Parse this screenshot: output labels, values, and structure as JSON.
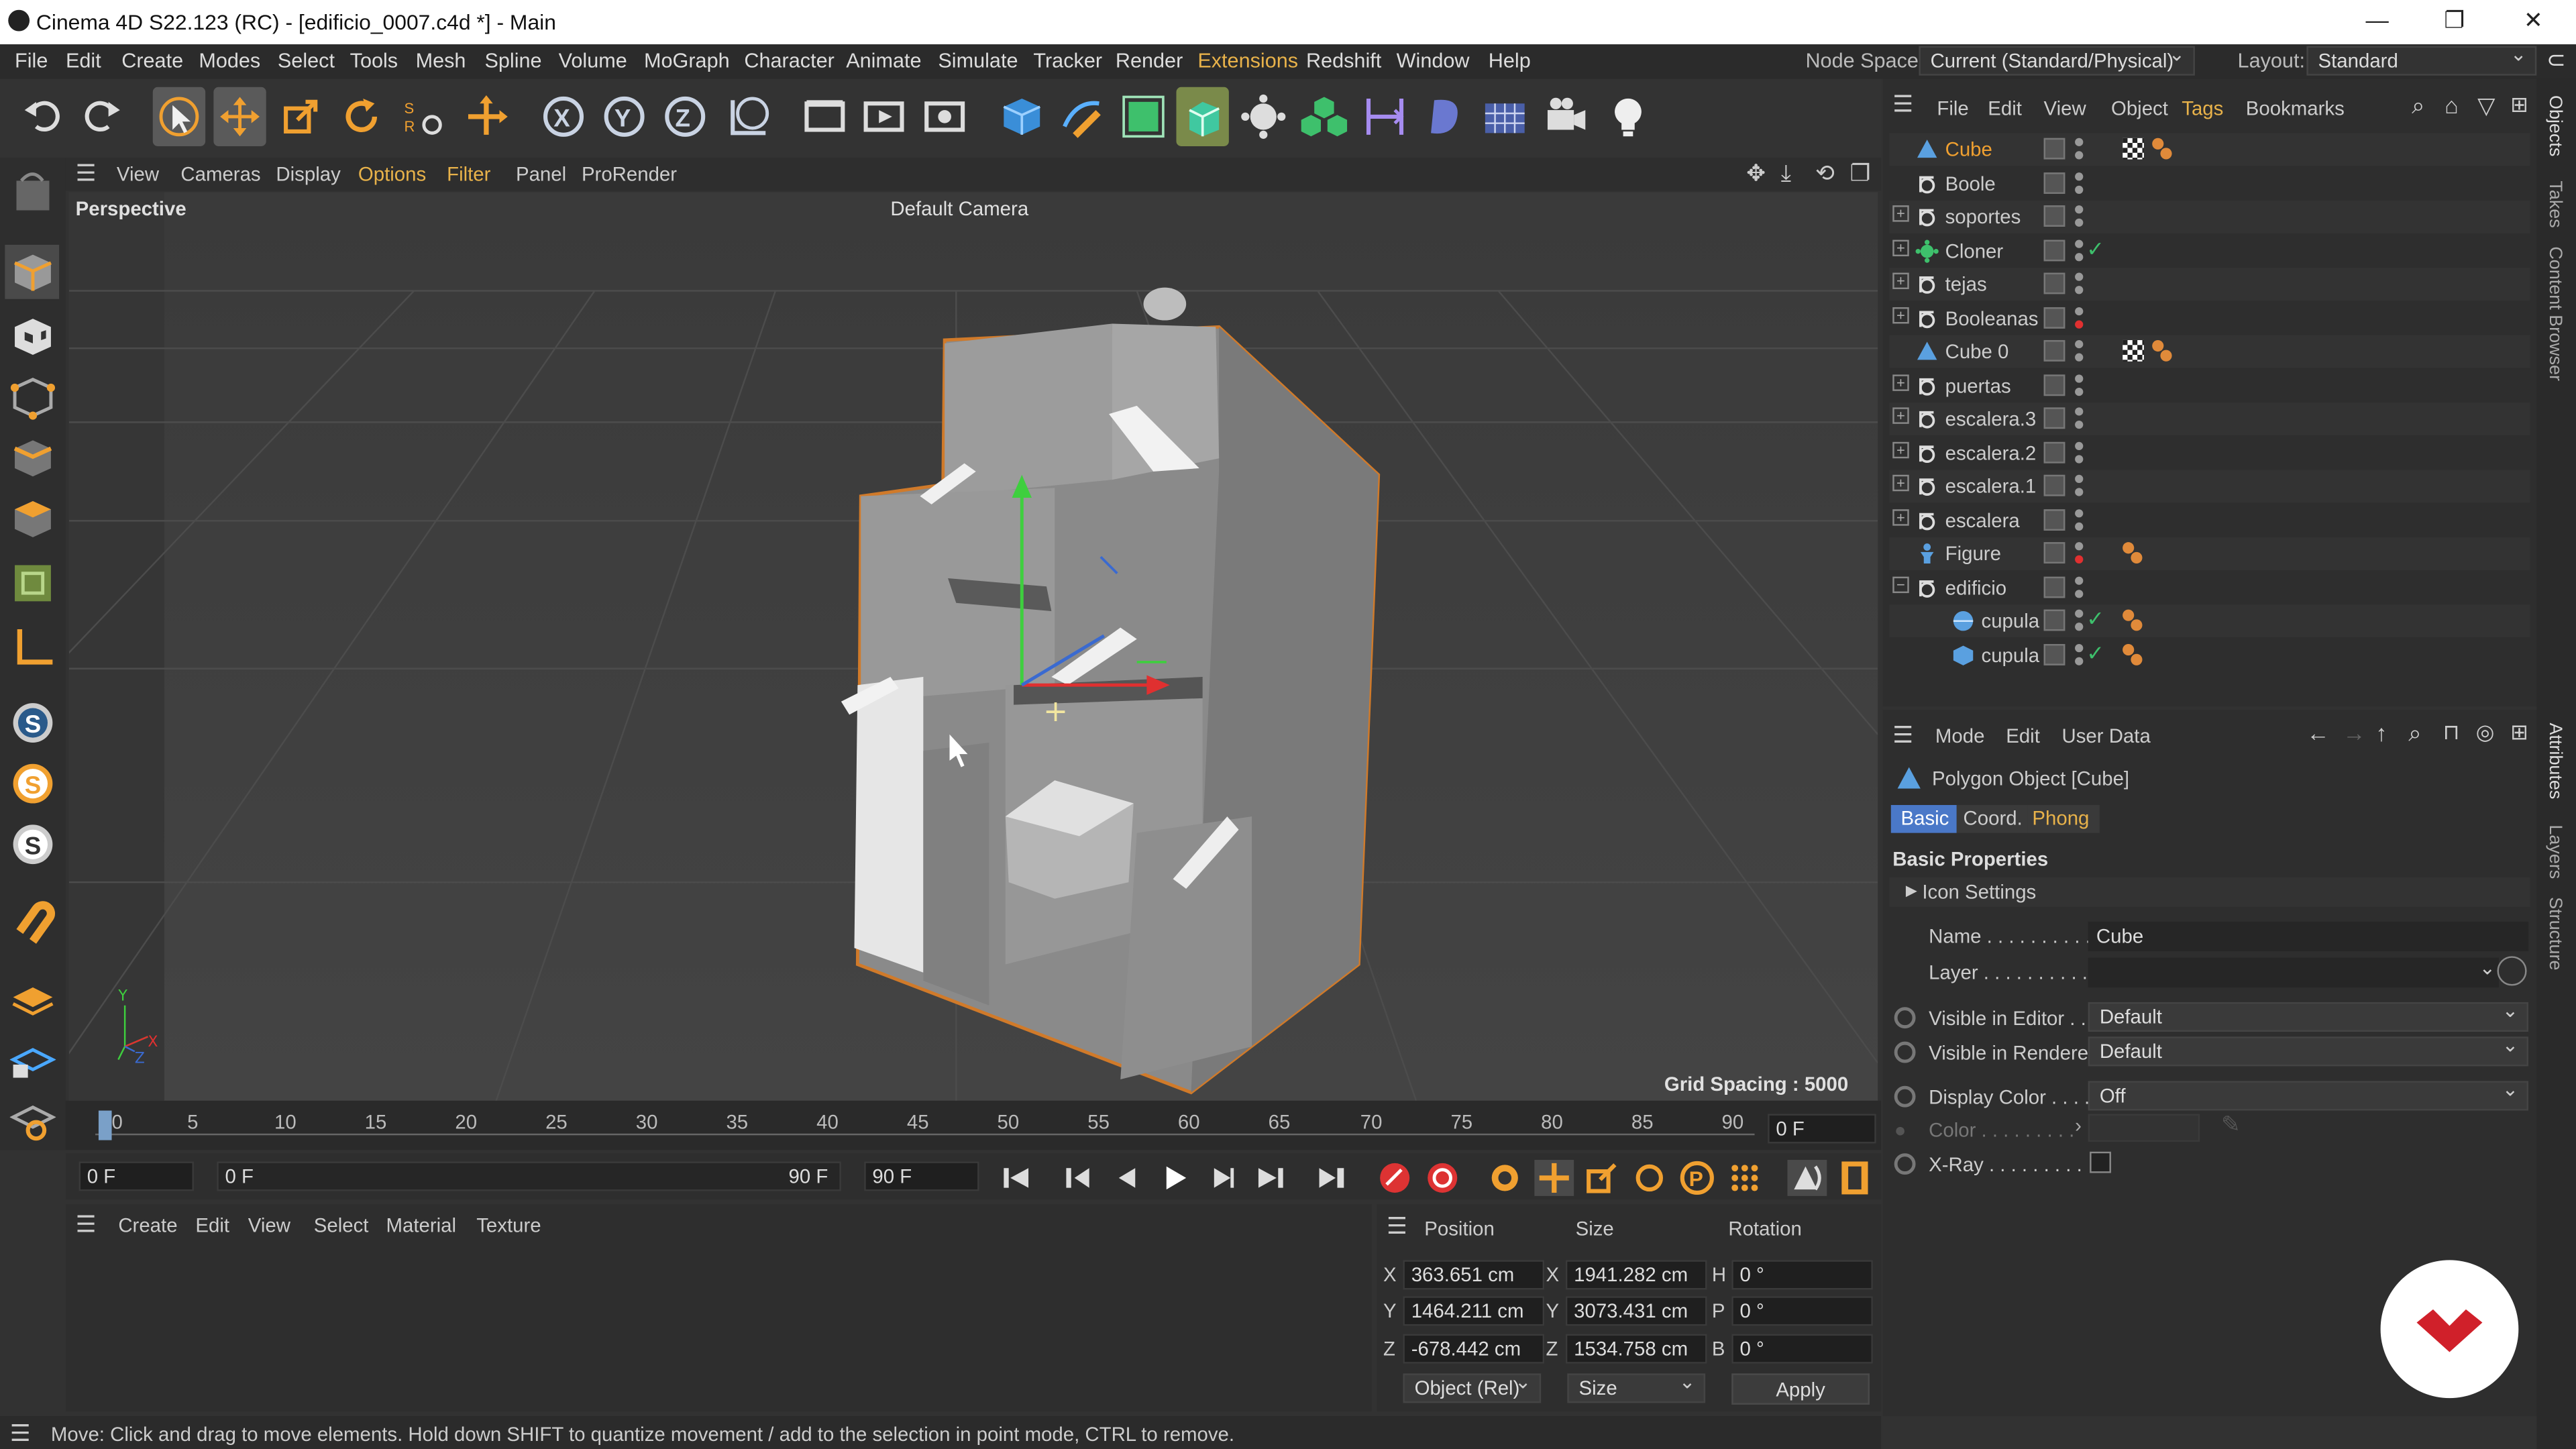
{
  "window": {
    "title": "Cinema 4D S22.123 (RC) - [edificio_0007.c4d *] - Main",
    "minimize": "—",
    "restore": "❐",
    "close": "✕"
  },
  "menu": [
    "File",
    "Edit",
    "Create",
    "Modes",
    "Select",
    "Tools",
    "Mesh",
    "Spline",
    "Volume",
    "MoGraph",
    "Character",
    "Animate",
    "Simulate",
    "Tracker",
    "Render",
    "Extensions",
    "Redshift",
    "Window",
    "Help"
  ],
  "node_space": {
    "label": "Node Space:",
    "value": "Current (Standard/Physical)"
  },
  "layout": {
    "label": "Layout:",
    "value": "Standard"
  },
  "viewport": {
    "menu": [
      "View",
      "Cameras",
      "Display",
      "Options",
      "Filter",
      "Panel",
      "ProRender"
    ],
    "name": "Perspective",
    "camera": "Default Camera",
    "grid_spacing": "Grid Spacing : 5000 cm"
  },
  "timeline": {
    "ticks": [
      "0",
      "5",
      "10",
      "15",
      "20",
      "25",
      "30",
      "35",
      "40",
      "45",
      "50",
      "55",
      "60",
      "65",
      "70",
      "75",
      "80",
      "85",
      "90"
    ],
    "current": "0 F",
    "start": "0 F",
    "range_start": "0 F",
    "range_end": "90 F",
    "end": "90 F"
  },
  "material_manager": {
    "menu": [
      "Create",
      "Edit",
      "View",
      "Select",
      "Material",
      "Texture"
    ]
  },
  "coordinates": {
    "headers": [
      "Position",
      "Size",
      "Rotation"
    ],
    "rows": [
      {
        "axis": "X",
        "pos": "363.651 cm",
        "size": "1941.282 cm",
        "rot_axis": "H",
        "rot": "0 °"
      },
      {
        "axis": "Y",
        "pos": "1464.211 cm",
        "size": "3073.431 cm",
        "rot_axis": "P",
        "rot": "0 °"
      },
      {
        "axis": "Z",
        "pos": "-678.442 cm",
        "size": "1534.758 cm",
        "rot_axis": "B",
        "rot": "0 °"
      }
    ],
    "mode": "Object (Rel)",
    "size_mode": "Size",
    "apply": "Apply"
  },
  "status": "Move: Click and drag to move elements. Hold down SHIFT to quantize movement / add to the selection in point mode, CTRL to remove.",
  "object_manager": {
    "menu": [
      "File",
      "Edit",
      "View",
      "Object",
      "Tags",
      "Bookmarks"
    ],
    "objects": [
      {
        "name": "Cube",
        "active": true
      },
      {
        "name": "Boole"
      },
      {
        "name": "soportes"
      },
      {
        "name": "Cloner"
      },
      {
        "name": "tejas"
      },
      {
        "name": "Booleanas"
      },
      {
        "name": "Cube 0"
      },
      {
        "name": "puertas"
      },
      {
        "name": "escalera.3"
      },
      {
        "name": "escalera.2"
      },
      {
        "name": "escalera.1"
      },
      {
        "name": "escalera"
      },
      {
        "name": "Figure"
      },
      {
        "name": "edificio"
      },
      {
        "name": "cupula"
      },
      {
        "name": "cupula"
      }
    ]
  },
  "attributes": {
    "menu": [
      "Mode",
      "Edit",
      "User Data"
    ],
    "object_title": "Polygon Object [Cube]",
    "tabs": [
      "Basic",
      "Coord.",
      "Phong"
    ],
    "section": "Basic Properties",
    "icon_settings": "Icon Settings",
    "name_label": "Name . . . . . . . . . .",
    "name_value": "Cube",
    "layer_label": "Layer . . . . . . . . . .",
    "visible_editor_label": "Visible in Editor . .",
    "visible_editor": "Default",
    "visible_renderer_label": "Visible in Renderer",
    "visible_renderer": "Default",
    "display_color_label": "Display Color . . . .",
    "display_color": "Off",
    "color_label": "Color . . . . . . . . .",
    "xray_label": "X-Ray . . . . . . . . ."
  },
  "side_tabs": [
    "Objects",
    "Takes",
    "Content Browser",
    "Attributes",
    "Layers",
    "Structure"
  ],
  "colors": {
    "accent": "#e8b24a",
    "selection": "#f0a030",
    "panel": "#2e2e2e",
    "viewport": "#3f3f3f"
  }
}
